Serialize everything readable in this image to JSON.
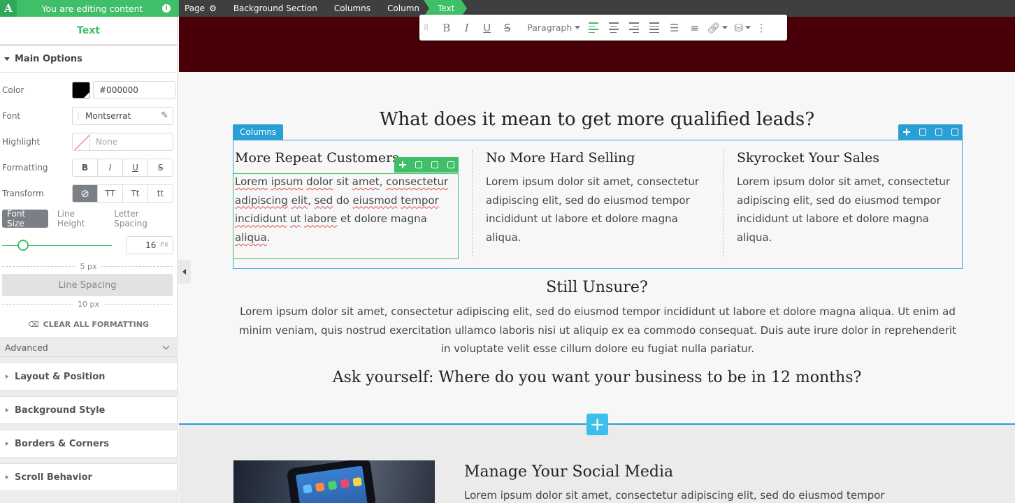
{
  "topbar": {
    "logo": "A",
    "editing_label": "You are editing content",
    "breadcrumbs": [
      "Page",
      "Background Section",
      "Columns",
      "Column",
      "Text"
    ]
  },
  "panel": {
    "title": "Text",
    "main_options": "Main Options",
    "color_label": "Color",
    "color_value": "#000000",
    "font_label": "Font",
    "font_value": "Montserrat",
    "highlight_label": "Highlight",
    "highlight_value": "None",
    "formatting_label": "Formatting",
    "formatting_buttons": [
      "B",
      "I",
      "U",
      "S"
    ],
    "transform_label": "Transform",
    "transform_buttons": [
      "⊘",
      "TT",
      "Tt",
      "tt"
    ],
    "size_tabs": [
      "Font Size",
      "Line Height",
      "Letter Spacing"
    ],
    "font_size_value": "16",
    "font_size_unit": "PX",
    "font_size_fraction": 0.19,
    "spacing_top": "5 px",
    "line_spacing": "Line Spacing",
    "spacing_bottom": "10 px",
    "clear_formatting": "CLEAR ALL FORMATTING",
    "advanced": "Advanced",
    "sections": [
      "Layout & Position",
      "Background Style",
      "Borders & Corners",
      "Scroll Behavior"
    ]
  },
  "toolbar": {
    "paragraph": "Paragraph"
  },
  "canvas": {
    "main_title": "What does it mean to get more qualified leads?",
    "columns_label": "Columns",
    "columns": [
      {
        "heading": "More Repeat Customers",
        "body": "Lorem ipsum dolor sit amet, consectetur adipiscing elit, sed do eiusmod tempor incididunt ut labore et dolore magna aliqua."
      },
      {
        "heading": "No More Hard Selling",
        "body": "Lorem ipsum dolor sit amet, consectetur adipiscing elit, sed do eiusmod tempor incididunt ut labore et dolore magna aliqua."
      },
      {
        "heading": "Skyrocket Your Sales",
        "body": "Lorem ipsum dolor sit amet, consectetur adipiscing elit, sed do eiusmod tempor incididunt ut labore et dolore magna aliqua."
      }
    ],
    "unsure_title": "Still Unsure?",
    "unsure_body": "Lorem ipsum dolor sit amet, consectetur adipiscing elit, sed do eiusmod tempor incididunt ut labore et dolore magna aliqua. Ut enim ad minim veniam, quis nostrud exercitation ullamco laboris nisi ut aliquip ex ea commodo consequat. Duis aute irure dolor in reprehenderit in voluptate velit esse cillum dolore eu fugiat nulla pariatur.",
    "ask_title": "Ask yourself: Where do you want your business to be in 12 months?",
    "add_section": "+",
    "social_title": "Manage Your Social Media",
    "social_body": "Lorem ipsum dolor sit amet, consectetur adipiscing elit, sed do eiusmod tempor"
  },
  "colors": {
    "accent_green": "#3fbf67",
    "accent_blue": "#2a9fd6",
    "hero_bg": "#4a0008",
    "topbar_bg": "#3e3f40"
  }
}
